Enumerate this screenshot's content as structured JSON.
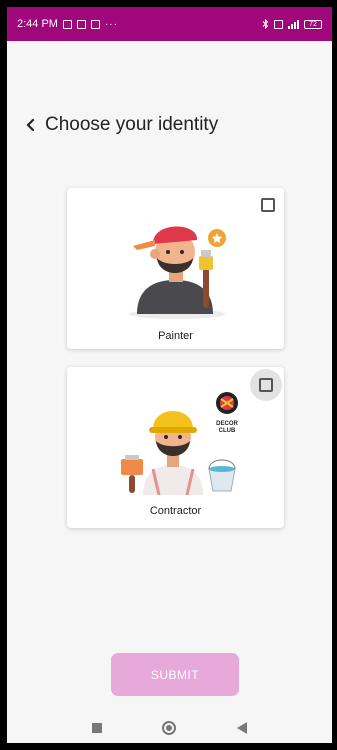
{
  "status_bar": {
    "time": "2:44 PM",
    "icons": [
      "gallery-icon",
      "trash-icon",
      "notification-icon",
      "more-dots-icon"
    ],
    "right_icons": [
      "bluetooth-icon",
      "sim-icon",
      "signal-icon",
      "battery-icon"
    ],
    "battery_level": "72",
    "color": "#a0077a"
  },
  "header": {
    "back_glyph": "‹",
    "title": "Choose your identity"
  },
  "cards": [
    {
      "label": "Painter",
      "checked": false
    },
    {
      "label": "Contractor",
      "checked": false,
      "badge_lines": [
        "DECOR",
        "CLUB"
      ]
    }
  ],
  "submit": {
    "label": "SUBMIT",
    "color": "#e7a9d9",
    "enabled": false
  },
  "nav_bar": {
    "icons": [
      "recents-square-icon",
      "home-circle-icon",
      "back-triangle-icon"
    ]
  }
}
